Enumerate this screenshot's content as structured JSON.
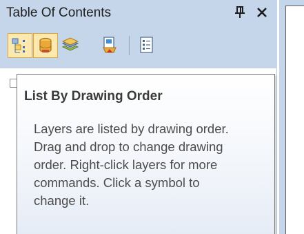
{
  "panel": {
    "title": "Table Of Contents",
    "pin_icon": "pin-icon",
    "close_icon": "close-icon"
  },
  "toolbar": {
    "buttons": [
      {
        "name": "list-by-drawing-order",
        "icon": "layers-list-icon",
        "active": true
      },
      {
        "name": "list-by-source",
        "icon": "database-icon",
        "active": true
      },
      {
        "name": "list-by-visibility",
        "icon": "layer-stack-icon",
        "active": false
      },
      {
        "name": "list-by-selection",
        "icon": "selection-icon",
        "active": false
      },
      {
        "name": "options",
        "icon": "options-list-icon",
        "active": false
      }
    ]
  },
  "tooltip": {
    "title": "List By Drawing Order",
    "lines": [
      "Layers are listed by drawing order.",
      "Drag and drop to change drawing",
      "order. Right-click layers for more",
      "commands. Click a symbol to",
      "change it."
    ]
  },
  "colors": {
    "chrome": "#c5d6ea",
    "active_button_fill": "#fbe9b0",
    "active_button_border": "#e2a73c",
    "tooltip_border": "#767676"
  }
}
